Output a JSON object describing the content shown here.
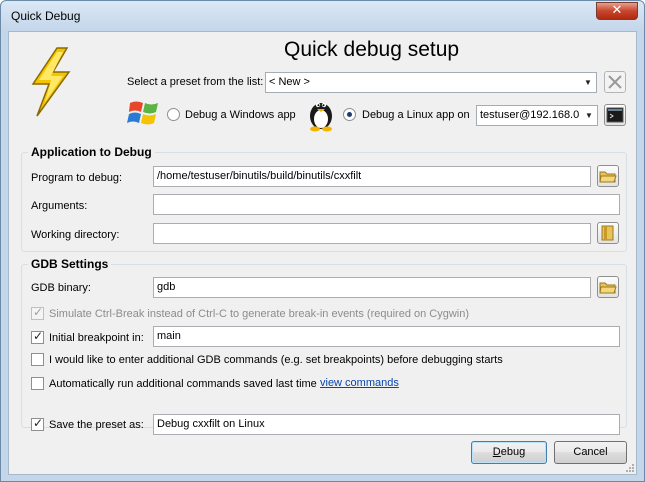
{
  "window": {
    "title": "Quick Debug",
    "close_glyph": "✕"
  },
  "header": {
    "title": "Quick debug setup"
  },
  "preset": {
    "label": "Select a preset from the list:",
    "value": "< New >",
    "delete_icon": "delete-x-icon"
  },
  "target": {
    "windows_label": "Debug a Windows app",
    "windows_selected": false,
    "linux_label": "Debug a Linux app on",
    "linux_selected": true,
    "host_value": "testuser@192.168.0"
  },
  "app_group": {
    "title": "Application to Debug",
    "program_label": "Program to debug:",
    "program_value": "/home/testuser/binutils/build/binutils/cxxfilt",
    "arguments_label": "Arguments:",
    "arguments_value": "",
    "workdir_label": "Working directory:",
    "workdir_value": ""
  },
  "gdb_group": {
    "title": "GDB Settings",
    "binary_label": "GDB binary:",
    "binary_value": "gdb",
    "ctrl_break_label": "Simulate Ctrl-Break instead of Ctrl-C to generate break-in events (required on Cygwin)",
    "ctrl_break_checked": true,
    "ctrl_break_enabled": false,
    "breakpoint_label": "Initial breakpoint in:",
    "breakpoint_checked": true,
    "breakpoint_value": "main",
    "additional_label": "I would like to enter additional GDB commands (e.g. set breakpoints) before debugging starts",
    "additional_checked": false,
    "autorun_label": "Automatically run additional commands saved last time",
    "autorun_checked": false,
    "view_commands_link": "view commands"
  },
  "save": {
    "label": "Save the preset as:",
    "checked": true,
    "value": "Debug cxxfilt on Linux"
  },
  "buttons": {
    "debug": "Debug",
    "cancel": "Cancel"
  },
  "icons": {
    "app": "lightning-bolt-icon",
    "windows": "windows-logo-icon",
    "linux": "tux-penguin-icon",
    "terminal": "terminal-icon",
    "browse": "folder-icon",
    "bookmark": "folder-bookmark-icon"
  },
  "colors": {
    "accent_link": "#0645ad",
    "bolt": "#f5c400",
    "close": "#c8452d"
  }
}
